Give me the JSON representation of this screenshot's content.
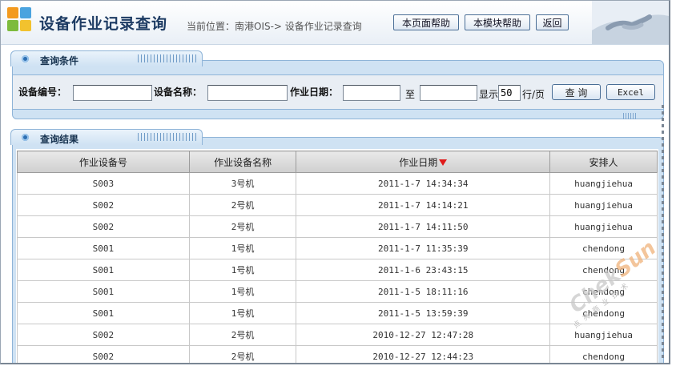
{
  "header": {
    "title": "设备作业记录查询",
    "breadcrumb": "当前位置：南港OIS-> 设备作业记录查询",
    "buttons": [
      "本页面帮助",
      "本模块帮助",
      "返回"
    ]
  },
  "query_panel": {
    "title": "查询条件",
    "device_no_label": "设备编号：",
    "device_no_value": "",
    "device_name_label": "设备名称：",
    "device_name_value": "",
    "work_date_label": "作业日期：",
    "date_from_value": "",
    "to_label": "至",
    "date_to_value": "",
    "show_label": "显示",
    "page_size_value": "50",
    "per_page_label": "行/页",
    "search_button": "查 询",
    "excel_button": "Excel"
  },
  "results_panel": {
    "title": "查询结果",
    "columns": [
      "作业设备号",
      "作业设备名称",
      "作业日期",
      "安排人"
    ],
    "sorted_column": "作业日期",
    "rows": [
      [
        "S003",
        "3号机",
        "2011-1-7 14:34:34",
        "huangjiehua"
      ],
      [
        "S002",
        "2号机",
        "2011-1-7 14:14:21",
        "huangjiehua"
      ],
      [
        "S002",
        "2号机",
        "2011-1-7 14:11:50",
        "huangjiehua"
      ],
      [
        "S001",
        "1号机",
        "2011-1-7 11:35:39",
        "chendong"
      ],
      [
        "S001",
        "1号机",
        "2011-1-6 23:43:15",
        "chendong"
      ],
      [
        "S001",
        "1号机",
        "2011-1-5 18:11:16",
        "chendong"
      ],
      [
        "S001",
        "1号机",
        "2011-1-5 13:59:39",
        "chendong"
      ],
      [
        "S002",
        "2号机",
        "2010-12-27 12:47:28",
        "huangjiehua"
      ],
      [
        "S002",
        "2号机",
        "2010-12-27 12:44:23",
        "chendong"
      ]
    ]
  },
  "watermark": {
    "text": "ChekSun",
    "sub": "点 亮 商 业 技 术"
  },
  "colors": {
    "accent": "#2d6fb3",
    "sort_arrow": "#e01b1b",
    "title": "#1d3b63"
  }
}
